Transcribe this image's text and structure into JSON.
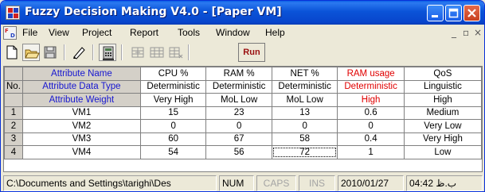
{
  "window": {
    "title": "Fuzzy Decision Making V4.0 - [Paper VM]"
  },
  "menu": {
    "items": [
      "File",
      "View",
      "Project",
      "Report",
      "Tools",
      "Window",
      "Help"
    ]
  },
  "toolbar": {
    "run_label": "Run"
  },
  "grid": {
    "header_rows": [
      {
        "label": "Attribute Name",
        "cells": [
          "CPU %",
          "RAM %",
          "NET %",
          "RAM usage",
          "QoS"
        ]
      },
      {
        "rowlabel": "No.",
        "label": "Attribute Data Type",
        "cells": [
          "Deterministic",
          "Deterministic",
          "Deterministic",
          "Deterministic",
          "Linguistic"
        ]
      },
      {
        "label": "Attribute Weight",
        "cells": [
          "Very High",
          "MoL Low",
          "MoL Low",
          "High",
          "High"
        ]
      }
    ],
    "rows": [
      {
        "no": "1",
        "name": "VM1",
        "values": [
          "15",
          "23",
          "13",
          "0.6",
          "Medium"
        ]
      },
      {
        "no": "2",
        "name": "VM2",
        "values": [
          "0",
          "0",
          "0",
          "0",
          "Very Low"
        ]
      },
      {
        "no": "3",
        "name": "VM3",
        "values": [
          "60",
          "67",
          "58",
          "0.4",
          "Very High"
        ]
      },
      {
        "no": "4",
        "name": "VM4",
        "values": [
          "54",
          "56",
          "72",
          "1",
          "Low"
        ]
      }
    ],
    "colors": {
      "header_text": "#1616d0",
      "highlight_text": "#e00000"
    }
  },
  "status": {
    "path": "C:\\Documents and Settings\\tarighi\\Des",
    "num": "NUM",
    "caps": "CAPS",
    "ins": "INS",
    "date": "2010/01/27",
    "time": "04:42 ب.ظ"
  },
  "icons": [
    "app-logo-icon",
    "minimize-icon",
    "maximize-icon",
    "close-icon",
    "new-file-icon",
    "open-folder-icon",
    "save-icon",
    "edit-pencil-icon",
    "calculator-icon",
    "insert-column-icon",
    "insert-between-icon",
    "delete-column-icon"
  ]
}
